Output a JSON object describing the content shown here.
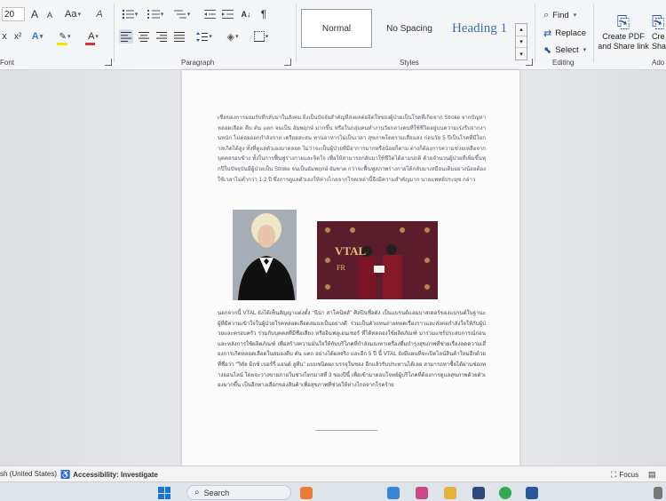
{
  "ribbon": {
    "font": {
      "label": "Font",
      "size_value": "20",
      "grow_label": "A",
      "shrink_label": "A",
      "case_label": "Aa",
      "clear_label": "A",
      "subscript_label": "x",
      "superscript_label": "x²",
      "effects_label": "A",
      "highlight_label": "✎",
      "color_label": "A",
      "highlight_color": "#f2e400",
      "font_color": "#d13438"
    },
    "paragraph": {
      "label": "Paragraph",
      "sort_label": "↓",
      "marks_label": "¶"
    },
    "styles": {
      "label": "Styles",
      "items": [
        "Normal",
        "No Spacing",
        "Heading 1"
      ]
    },
    "editing": {
      "label": "Editing",
      "find_label": "Find",
      "replace_label": "Replace",
      "select_label": "Select"
    },
    "adobe": {
      "create_pdf_label": "Create PDF and Share link",
      "create_share_label": "Cre Shar",
      "group_label": "Ado"
    },
    "accent_color": "#2b579a"
  },
  "document": {
    "para_top": "เชื่อของการยอมรับที่กลับมาในสังคม ยิ่งเป็นปัจจัยสำคัญที่ส่งผลต่อจิตใจของผู้ป่วยเป็นโรคที่เกิดจาก Stroke จากปัญหาหลอดเลือด ตีบ ตัน แตก จนเป็น อัมพฤกษ์ มากขึ้น หรือในกลุ่มคนทำงานวัยกลางคนที่ใช้ชีวิตอยู่บนความเร่งรีบจากงานหนัก ไม่ค่อยออกกำลังกาย เครียดสะสม ทานอาหารไม่เป็นเวลา สุขภาพโดยรวมเสื่อมลง ก่อนวัย 5 ปีเป็นโรคที่มีโอกาสเกิดได้สูง ทั้งที่ดูแลตัวเองมาตลอด ไม่ว่าจะเป็นผู้ป่วยที่มีอาการมากหรือน้อยก็ตาม ต่างก็ต้องการความช่วยเหลือจากบุคคลรอบข้าง ทั้งในการฟื้นฟูร่างกายและจิตใจ เพื่อให้สามารถกลับมาใช้ชีวิตได้ตามปกติ ด้วยจำนวนผู้ป่วยที่เพิ่มขึ้นทุกปีในปัจจุบันมีผู้ป่วยเป็น Stroke จนเป็นอัมพฤกษ์ อัมพาต กว่าจะฟื้นฟูสภาพร่างกายได้กลับมาเหมือนเดิมอย่างน้อยต้องใช้เวลาไม่ต่ำกว่า 1-2 ปี ซึ่งการดูแลตัวเองให้ห่างไกลจากโรคเหล่านี้จึงมีความสำคัญมาก",
    "para_top_end": "นายแพทย์ประมุข กล่าว",
    "para_bottom": "นอกจากนี้ VTAL ยังได้เซ็นสัญญาแต่งตั้ง “นีน่า สาโคนิทส์” ศิลปินชื่อดัง เป็นแบรนด์แอมบาสเดอร์ของแบรนด์ในฐานะผู้ที่มีความเข้าใจในผู้ป่วยโรคหลอดเลือดสมองเป็นอย่างดี ร่วมเป็นตัวแทนถ่ายทอดเรื่องราวและส่งต่อกำลังใจให้กับผู้ป่วยและครอบครัว ร่วมกับบุคคลที่มีชื่อเสียง หรืออินฟลูเอนเซอร์ ที่ได้ทดลองใช้ผลิตภัณฑ์ มาร่วมแชร์ประสบการณ์ก่อนและหลังการใช้ผลิตภัณฑ์ เพื่อสร้างความมั่นใจให้กับบริโภคที่กำลังมองหาเครื่องดื่มบำรุงสุขภาพที่ช่วยเรื่องลดความเสี่ยงการเกิดหลอดเลือดในสมองตีบ ตัน แตก อย่างได้ผลจริง และอีก 5 ปี นี้ VTAL ยังมีแผนที่จะเปิดไลน์สินค้าใหม่อีกด้วย ที่ชื่อว่า “วิทัล มิกซ์ เบอร์รี่ แอนด์ ลูทีน” แบบชนิดผง บรรจุในซอง อีกแล้วรับประทานได้เลย สามารถหาซื้อได้ผ่านช่องทางออนไลน์ โดยจะวางขายภายในช่วงไตรมาสที่ 3 ของปีนี้ เพื่อเข้ามาตอบโจทย์ผู้บริโภคที่ต้องการดูแลสุขภาพด้วยตัวเองมากขึ้น เป็นอีกทางเลือกของสินค้าเพื่อสุขภาพที่ช่วยให้ห่างไกลจากโรคร้าย"
  },
  "photo2": {
    "banner_text": "VTAL",
    "banner_text_2": "FR"
  },
  "status": {
    "language": "sh (United States)",
    "accessibility": "Accessibility: Investigate",
    "focus": "Focus"
  },
  "taskbar": {
    "search_placeholder": "Search"
  }
}
